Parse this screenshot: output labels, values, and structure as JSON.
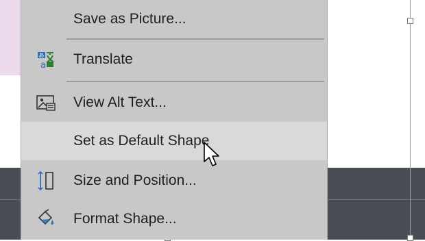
{
  "menu": {
    "items": [
      {
        "label": "Save as Picture...",
        "icon": "none"
      },
      {
        "label": "Translate",
        "icon": "translate-icon"
      },
      {
        "label": "View Alt Text...",
        "icon": "alt-text-icon"
      },
      {
        "label": "Set as Default Shape",
        "icon": "none"
      },
      {
        "label": "Size and Position...",
        "icon": "size-position-icon"
      },
      {
        "label": "Format Shape...",
        "icon": "format-shape-icon"
      }
    ],
    "hovered_item": "Set as Default Shape"
  },
  "colors": {
    "menu_bg": "#c8c8c8",
    "hover_bg": "#d9d9d9",
    "dark_band": "#4a4d56",
    "pink_area": "#ecd9ec",
    "accent_green": "#2e7d32",
    "accent_blue": "#2f6fb3"
  }
}
